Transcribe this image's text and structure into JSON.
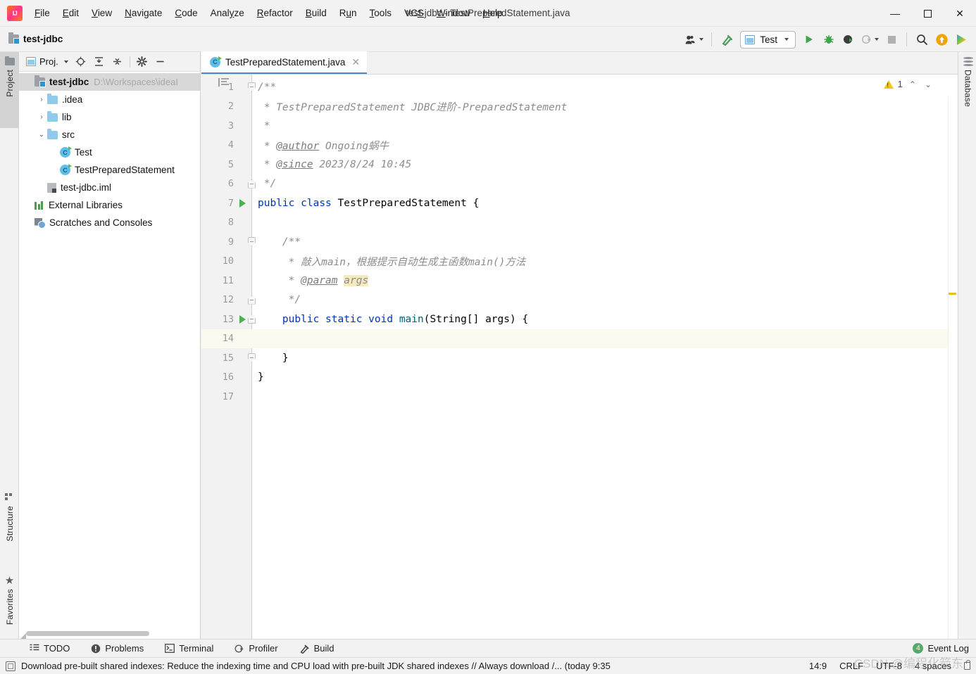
{
  "window": {
    "title": "test-jdbc - TestPreparedStatement.java",
    "minimize": "—",
    "maximize": "☐",
    "close": "✕"
  },
  "menu": {
    "items": [
      {
        "pre": "",
        "mn": "F",
        "post": "ile"
      },
      {
        "pre": "",
        "mn": "E",
        "post": "dit"
      },
      {
        "pre": "",
        "mn": "V",
        "post": "iew"
      },
      {
        "pre": "",
        "mn": "N",
        "post": "avigate"
      },
      {
        "pre": "",
        "mn": "C",
        "post": "ode"
      },
      {
        "pre": "Anal",
        "mn": "y",
        "post": "ze"
      },
      {
        "pre": "",
        "mn": "R",
        "post": "efactor"
      },
      {
        "pre": "",
        "mn": "B",
        "post": "uild"
      },
      {
        "pre": "R",
        "mn": "u",
        "post": "n"
      },
      {
        "pre": "",
        "mn": "T",
        "post": "ools"
      },
      {
        "pre": "VC",
        "mn": "S",
        "post": ""
      },
      {
        "pre": "",
        "mn": "W",
        "post": "indow"
      },
      {
        "pre": "",
        "mn": "H",
        "post": "elp"
      }
    ]
  },
  "navbar": {
    "breadcrumb": "test-jdbc",
    "run_config": "Test",
    "icons": {
      "account": "account-icon",
      "build_hammer": "hammer-icon",
      "run": "run-icon",
      "debug": "debug-icon",
      "run_coverage": "run-with-coverage-icon",
      "profile": "profile-icon",
      "stop": "stop-icon",
      "search": "search-everywhere-icon",
      "update": "update-project-icon",
      "idea_assist": "assistant-icon"
    }
  },
  "left_strip": {
    "project_tab": "Project",
    "structure_tab": "Structure",
    "favorites_tab": "Favorites"
  },
  "right_strip": {
    "database_tab": "Database"
  },
  "project_panel": {
    "title": "Proj.",
    "header_buttons": [
      "locate-icon",
      "expand-all-icon",
      "collapse-all-icon",
      "settings-gear-icon",
      "hide-panel-icon"
    ],
    "tree": [
      {
        "depth": 0,
        "arrow": "",
        "icon": "module",
        "label": "test-jdbc",
        "bold": true,
        "sub": "D:\\Workspaces\\ideaI",
        "selected": true
      },
      {
        "depth": 1,
        "arrow": "›",
        "icon": "folder",
        "label": ".idea",
        "bold": false,
        "sub": "",
        "selected": false
      },
      {
        "depth": 1,
        "arrow": "›",
        "icon": "folder",
        "label": "lib",
        "bold": false,
        "sub": "",
        "selected": false
      },
      {
        "depth": 1,
        "arrow": "⌄",
        "icon": "folder",
        "label": "src",
        "bold": false,
        "sub": "",
        "selected": false
      },
      {
        "depth": 2,
        "arrow": "",
        "icon": "class",
        "label": "Test",
        "bold": false,
        "sub": "",
        "selected": false
      },
      {
        "depth": 2,
        "arrow": "",
        "icon": "class",
        "label": "TestPreparedStatement",
        "bold": false,
        "sub": "",
        "selected": false
      },
      {
        "depth": 1,
        "arrow": "",
        "icon": "iml",
        "label": "test-jdbc.iml",
        "bold": false,
        "sub": "",
        "selected": false
      },
      {
        "depth": 0,
        "arrow": "",
        "icon": "lib",
        "label": "External Libraries",
        "bold": false,
        "sub": "",
        "selected": false
      },
      {
        "depth": 0,
        "arrow": "",
        "icon": "scratch",
        "label": "Scratches and Consoles",
        "bold": false,
        "sub": "",
        "selected": false
      }
    ]
  },
  "editor": {
    "tab": {
      "label": "TestPreparedStatement.java",
      "close": "✕",
      "icon": "java-class-icon"
    },
    "inspection": {
      "count": "1",
      "up": "⌃",
      "down": "⌄"
    },
    "lines": [
      {
        "n": "1",
        "text": "/**",
        "type": "comment",
        "run": false,
        "fold": "top"
      },
      {
        "n": "2",
        "text": " * TestPreparedStatement JDBC进阶-PreparedStatement",
        "type": "comment",
        "run": false,
        "fold": ""
      },
      {
        "n": "3",
        "text": " *",
        "type": "comment",
        "run": false,
        "fold": ""
      },
      {
        "n": "4",
        "text": " * @author Ongoing蜗牛",
        "type": "comment-tag",
        "tag": "@author",
        "rest": " Ongoing蜗牛",
        "run": false,
        "fold": ""
      },
      {
        "n": "5",
        "text": " * @since 2023/8/24 10:45",
        "type": "comment-tag",
        "tag": "@since",
        "rest": " 2023/8/24 10:45",
        "run": false,
        "fold": ""
      },
      {
        "n": "6",
        "text": " */",
        "type": "comment",
        "run": false,
        "fold": "bot"
      },
      {
        "n": "7",
        "text": "public class TestPreparedStatement {",
        "type": "code-class",
        "run": true,
        "fold": ""
      },
      {
        "n": "8",
        "text": "",
        "type": "blank",
        "run": false,
        "fold": ""
      },
      {
        "n": "9",
        "text": "    /**",
        "type": "comment",
        "run": false,
        "fold": "top"
      },
      {
        "n": "10",
        "text": "     * 敲入main，根据提示自动生成主函数main()方法",
        "type": "comment",
        "run": false,
        "fold": ""
      },
      {
        "n": "11",
        "text": "     * @param args",
        "type": "comment-param",
        "tag": "@param",
        "rest": "args",
        "run": false,
        "fold": ""
      },
      {
        "n": "12",
        "text": "     */",
        "type": "comment",
        "run": false,
        "fold": "bot"
      },
      {
        "n": "13",
        "text": "    public static void main(String[] args) {",
        "type": "code-main",
        "run": true,
        "fold": "bot"
      },
      {
        "n": "14",
        "text": "",
        "type": "blank",
        "run": false,
        "fold": "",
        "highlight": true
      },
      {
        "n": "15",
        "text": "    }",
        "type": "code-plain",
        "run": false,
        "fold": "top"
      },
      {
        "n": "16",
        "text": "}",
        "type": "code-plain",
        "run": false,
        "fold": ""
      },
      {
        "n": "17",
        "text": "",
        "type": "blank",
        "run": false,
        "fold": ""
      }
    ]
  },
  "bottom_bar": {
    "items": [
      {
        "label": "TODO",
        "icon": "todo-list-icon"
      },
      {
        "label": "Problems",
        "icon": "problems-icon"
      },
      {
        "label": "Terminal",
        "icon": "terminal-icon"
      },
      {
        "label": "Profiler",
        "icon": "profiler-icon"
      },
      {
        "label": "Build",
        "icon": "build-hammer-icon"
      }
    ],
    "event_log": {
      "label": "Event Log",
      "count": "4"
    }
  },
  "statusbar": {
    "message": "Download pre-built shared indexes: Reduce the indexing time and CPU load with pre-built JDK shared indexes // Always download /... (today 9:35",
    "caret": "14:9",
    "line_separator": "CRLF",
    "encoding": "UTF-8",
    "indent": "4 spaces"
  },
  "watermark": "CSDN @编程化箭东",
  "colors": {
    "accent_blue": "#4a86c8",
    "keyword": "#0033b3",
    "comment": "#8c8c8c",
    "run_green": "#4caf50",
    "warning_yellow": "#f2c811",
    "folder_blue": "#8ecbea",
    "selected_row": "#d8d8d8",
    "caret_row": "#fcfaef"
  }
}
